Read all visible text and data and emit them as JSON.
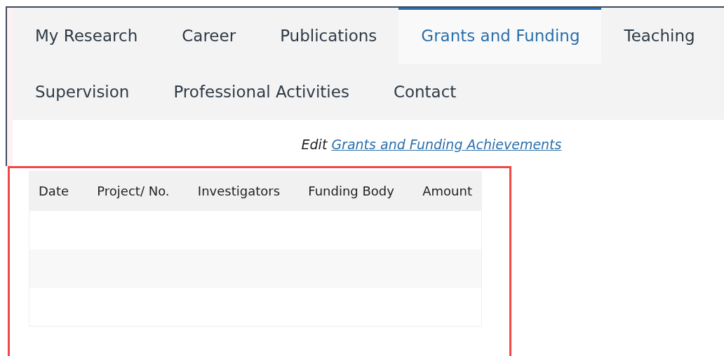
{
  "nav": {
    "tabs": [
      {
        "label": "My Research",
        "selected": false
      },
      {
        "label": "Career",
        "selected": false
      },
      {
        "label": "Publications",
        "selected": false
      },
      {
        "label": "Grants and Funding",
        "selected": true
      },
      {
        "label": "Teaching",
        "selected": false
      },
      {
        "label": "Supervision",
        "selected": false
      },
      {
        "label": "Professional Activities",
        "selected": false
      },
      {
        "label": "Contact",
        "selected": false
      }
    ]
  },
  "edit_prompt": {
    "prefix": "Edit",
    "link": "Grants and Funding Achievements"
  },
  "table": {
    "columns": [
      "Date",
      "Project/ No.",
      "Investigators",
      "Funding Body",
      "Amount"
    ]
  }
}
